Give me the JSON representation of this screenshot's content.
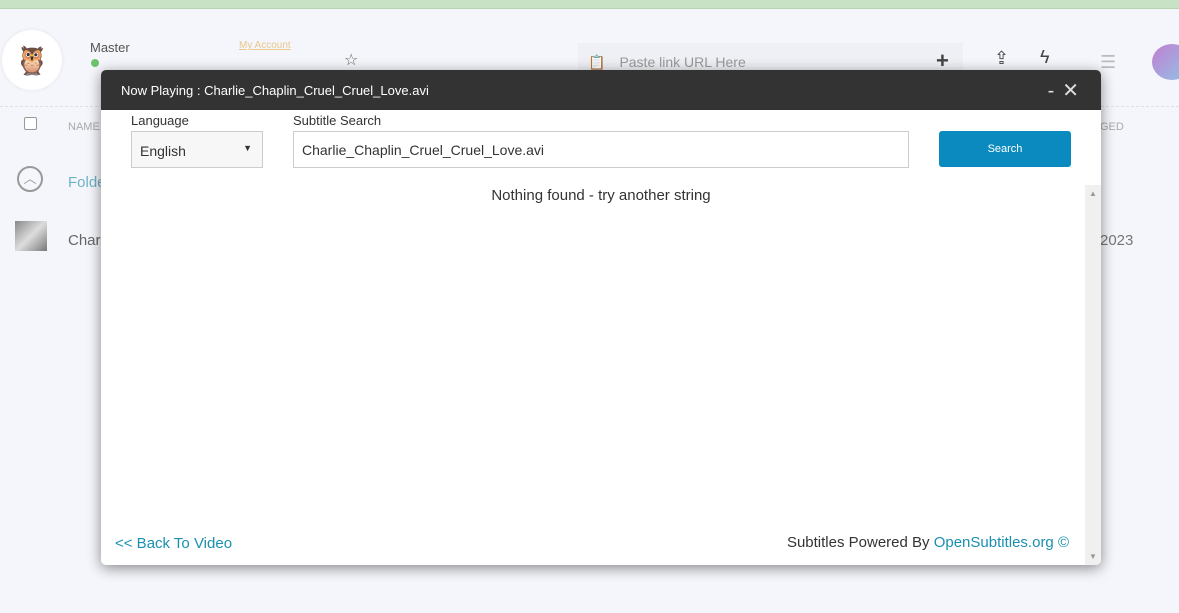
{
  "background": {
    "user_name": "Master",
    "my_account": "My Account",
    "url_placeholder": "Paste link URL Here",
    "column_name": "NAME",
    "column_changed_partial": "GED",
    "folder_partial": "Folde",
    "file_partial": "Char",
    "date_partial": "2023"
  },
  "modal": {
    "title": "Now Playing : Charlie_Chaplin_Cruel_Cruel_Love.avi",
    "minimize": "-",
    "close": "✕",
    "language_label": "Language",
    "language_value": "English",
    "search_label": "Subtitle Search",
    "search_value": "Charlie_Chaplin_Cruel_Cruel_Love.avi",
    "search_button": "Search",
    "message": "Nothing found - try another string",
    "back_link": "<< Back To Video",
    "powered_by": "Subtitles Powered By",
    "powered_link": "OpenSubtitles.org ©"
  },
  "colors": {
    "accent": "#0a8abf",
    "header": "#333333",
    "link": "#1a8fb0"
  }
}
